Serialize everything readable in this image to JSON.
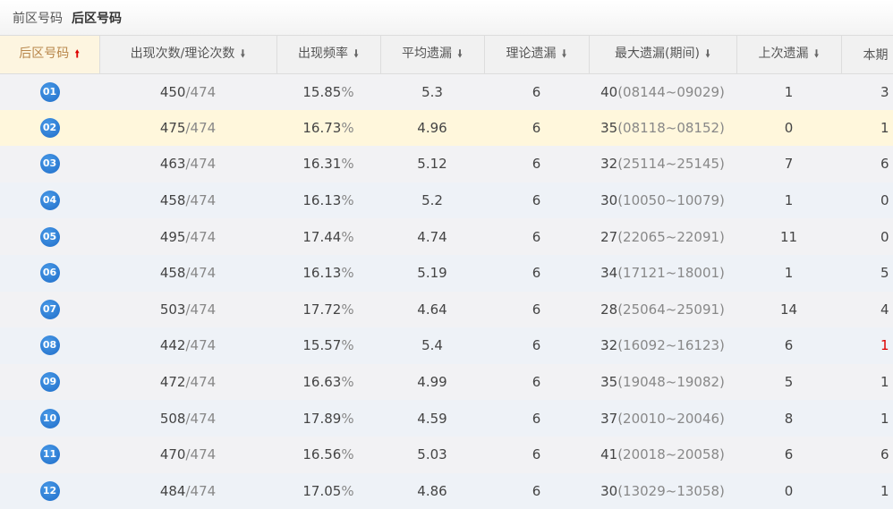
{
  "tabs": [
    "前区号码",
    "后区号码"
  ],
  "headers": [
    "后区号码",
    "出现次数/理论次数",
    "出现频率",
    "平均遗漏",
    "理论遗漏",
    "最大遗漏(期间)",
    "上次遗漏",
    "本期"
  ],
  "rows": [
    {
      "no": "01",
      "count": "450",
      "theory": "/474",
      "freq": "15.85",
      "pct": "%",
      "avg": "5.3",
      "theo": "6",
      "max": "40",
      "range": "(08144~09029)",
      "last": "1",
      "cur": "3"
    },
    {
      "no": "02",
      "count": "475",
      "theory": "/474",
      "freq": "16.73",
      "pct": "%",
      "avg": "4.96",
      "theo": "6",
      "max": "35",
      "range": "(08118~08152)",
      "last": "0",
      "cur": "1"
    },
    {
      "no": "03",
      "count": "463",
      "theory": "/474",
      "freq": "16.31",
      "pct": "%",
      "avg": "5.12",
      "theo": "6",
      "max": "32",
      "range": "(25114~25145)",
      "last": "7",
      "cur": "6"
    },
    {
      "no": "04",
      "count": "458",
      "theory": "/474",
      "freq": "16.13",
      "pct": "%",
      "avg": "5.2",
      "theo": "6",
      "max": "30",
      "range": "(10050~10079)",
      "last": "1",
      "cur": "0"
    },
    {
      "no": "05",
      "count": "495",
      "theory": "/474",
      "freq": "17.44",
      "pct": "%",
      "avg": "4.74",
      "theo": "6",
      "max": "27",
      "range": "(22065~22091)",
      "last": "11",
      "cur": "0"
    },
    {
      "no": "06",
      "count": "458",
      "theory": "/474",
      "freq": "16.13",
      "pct": "%",
      "avg": "5.19",
      "theo": "6",
      "max": "34",
      "range": "(17121~18001)",
      "last": "1",
      "cur": "5"
    },
    {
      "no": "07",
      "count": "503",
      "theory": "/474",
      "freq": "17.72",
      "pct": "%",
      "avg": "4.64",
      "theo": "6",
      "max": "28",
      "range": "(25064~25091)",
      "last": "14",
      "cur": "4"
    },
    {
      "no": "08",
      "count": "442",
      "theory": "/474",
      "freq": "15.57",
      "pct": "%",
      "avg": "5.4",
      "theo": "6",
      "max": "32",
      "range": "(16092~16123)",
      "last": "6",
      "cur": "1"
    },
    {
      "no": "09",
      "count": "472",
      "theory": "/474",
      "freq": "16.63",
      "pct": "%",
      "avg": "4.99",
      "theo": "6",
      "max": "35",
      "range": "(19048~19082)",
      "last": "5",
      "cur": "1"
    },
    {
      "no": "10",
      "count": "508",
      "theory": "/474",
      "freq": "17.89",
      "pct": "%",
      "avg": "4.59",
      "theo": "6",
      "max": "37",
      "range": "(20010~20046)",
      "last": "8",
      "cur": "1"
    },
    {
      "no": "11",
      "count": "470",
      "theory": "/474",
      "freq": "16.56",
      "pct": "%",
      "avg": "5.03",
      "theo": "6",
      "max": "41",
      "range": "(20018~20058)",
      "last": "6",
      "cur": "6"
    },
    {
      "no": "12",
      "count": "484",
      "theory": "/474",
      "freq": "17.05",
      "pct": "%",
      "avg": "4.86",
      "theo": "6",
      "max": "30",
      "range": "(13029~13058)",
      "last": "0",
      "cur": "1"
    }
  ],
  "colors": {
    "ball": "#1e6cc8",
    "highlight": "#fff7dc",
    "sorted_header": "#fdf5e0",
    "red": "#dd0000"
  }
}
